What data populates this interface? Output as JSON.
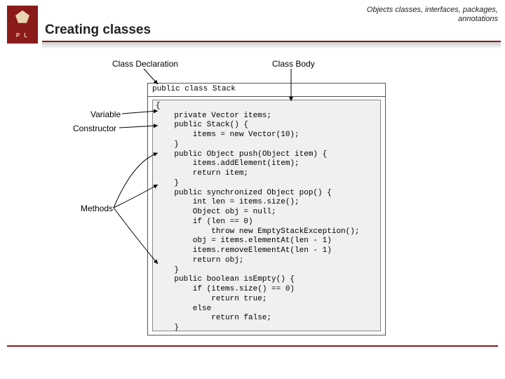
{
  "header": {
    "title": "Creating classes",
    "subtitle_line1": "Objects classes, interfaces, packages,",
    "subtitle_line2": "annotations",
    "logo_letters": "P   L"
  },
  "labels": {
    "class_declaration": "Class Declaration",
    "class_body": "Class Body",
    "variable": "Variable",
    "constructor": "Constructor",
    "methods": "Methods"
  },
  "code": {
    "declaration": "public class Stack",
    "body": "{\n    private Vector items;\n    public Stack() {\n        items = new Vector(10);\n    }\n    public Object push(Object item) {\n        items.addElement(item);\n        return item;\n    }\n    public synchronized Object pop() {\n        int len = items.size();\n        Object obj = null;\n        if (len == 0)\n            throw new EmptyStackException();\n        obj = items.elementAt(len - 1)\n        items.removeElementAt(len - 1)\n        return obj;\n    }\n    public boolean isEmpty() {\n        if (items.size() == 0)\n            return true;\n        else\n            return false;\n    }\n}"
  }
}
